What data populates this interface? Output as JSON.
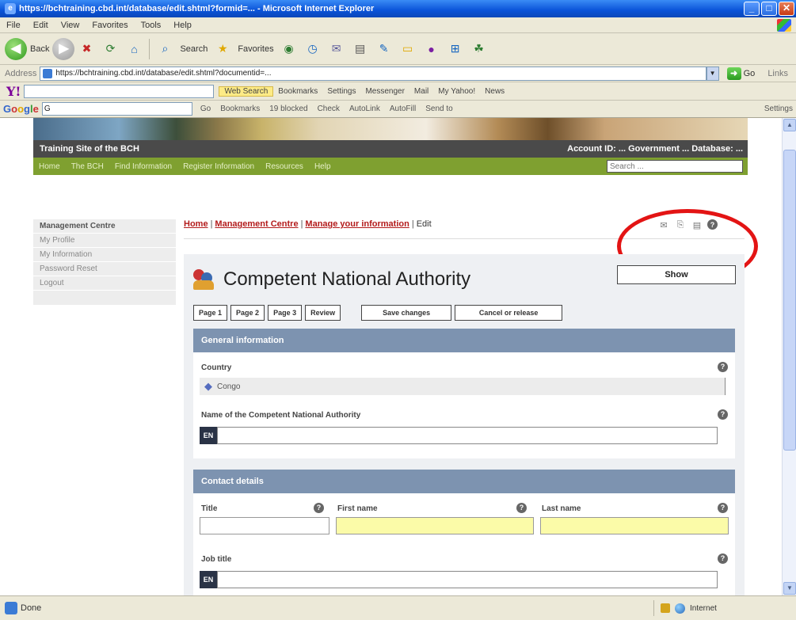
{
  "window": {
    "title": "https://bchtraining.cbd.int/database/edit.shtml?formid=... - Microsoft Internet Explorer",
    "minimize": "_",
    "maximize": "□",
    "close": "✕"
  },
  "menubar": {
    "items": [
      "File",
      "Edit",
      "View",
      "Favorites",
      "Tools",
      "Help"
    ]
  },
  "navbar": {
    "back_label": "Back",
    "search_label": "Search",
    "favorites_label": "Favorites"
  },
  "addressbar": {
    "label": "Address",
    "url": "https://bchtraining.cbd.int/database/edit.shtml?documentid=...",
    "go_label": "Go",
    "links_label": "Links"
  },
  "yahoobar": {
    "logo": "Y!",
    "web_search": "Web Search",
    "bookmarks": "Bookmarks",
    "settings": "Settings",
    "messenger": "Messenger",
    "mail": "Mail",
    "myyahoo": "My Yahoo!",
    "news": "News"
  },
  "googlebar": {
    "logo": "Google",
    "query": "G",
    "go": "Go",
    "bookmarks": "Bookmarks",
    "blocked": "19 blocked",
    "check": "Check",
    "autolink": "AutoLink",
    "autofill": "AutoFill",
    "sendto": "Send to",
    "settings": "Settings"
  },
  "site": {
    "title": "Training Site of the BCH",
    "account": "Account ID: ... Government ... Database: ...",
    "nav": [
      "Home",
      "The BCH",
      "Find Information",
      "Register Information",
      "Resources",
      "Help"
    ],
    "search_placeholder": "Search ..."
  },
  "sidebar": {
    "items": [
      "Management Centre",
      "My Profile",
      "My Information",
      "Password Reset",
      "Logout"
    ]
  },
  "breadcrumb": {
    "home": "Home",
    "management": "Management Centre",
    "manage": "Manage your information",
    "current": "Edit"
  },
  "form": {
    "title": "Competent National Authority",
    "show_button": "Show",
    "pages": [
      "Page 1",
      "Page 2",
      "Page 3",
      "Review"
    ],
    "save": "Save changes",
    "cancel": "Cancel or release",
    "general": {
      "heading": "General information",
      "country_label": "Country",
      "country_value": "Congo",
      "cna_name_label": "Name of the Competent National Authority",
      "lang_tag": "EN"
    },
    "contact": {
      "heading": "Contact details",
      "title_label": "Title",
      "first_name_label": "First name",
      "last_name_label": "Last name",
      "job_title_label": "Job title",
      "lang_tag": "EN"
    }
  },
  "statusbar": {
    "text": "Done",
    "zone": "Internet"
  }
}
